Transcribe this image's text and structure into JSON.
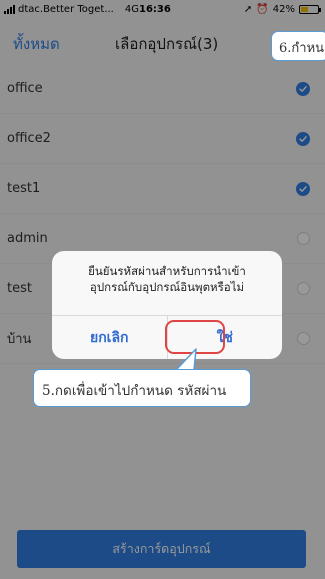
{
  "status_bar": {
    "carrier": "dtac.Better Toget...",
    "network": "4G",
    "time": "16:36",
    "battery": "42%",
    "battery_level": 0.42
  },
  "nav": {
    "back_label": "ทั้งหมด",
    "title": "เลือกอุปกรณ์(3)"
  },
  "annotations": {
    "step6": "6.กำหน",
    "step5": "5.กดเพื่อเข้าไปกำหนด รหัสผ่าน"
  },
  "devices": [
    {
      "label": "office",
      "selected": true
    },
    {
      "label": "office2",
      "selected": true
    },
    {
      "label": "test1",
      "selected": true
    },
    {
      "label": "admin",
      "selected": false
    },
    {
      "label": "test",
      "selected": false
    },
    {
      "label": "บ้าน",
      "selected": false
    }
  ],
  "dialog": {
    "message_line1": "ยืนยันรหัสผ่านสำหรับการนำเข้า",
    "message_line2": "อุปกรณ์กับอุปกรณ์อินพุตหรือไม่",
    "cancel_label": "ยกเลิก",
    "confirm_label": "ใช่"
  },
  "footer": {
    "create_label": "สร้างการ์ดอุปกรณ์"
  },
  "colors": {
    "accent": "#2f7de1",
    "highlight_ring": "#e04545",
    "callout_border": "#5b9bd5"
  }
}
